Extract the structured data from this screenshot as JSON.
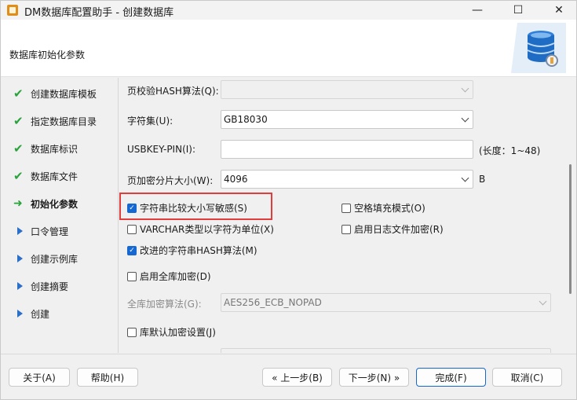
{
  "window": {
    "title": "DM数据库配置助手 - 创建数据库",
    "minimize": "—",
    "maximize": "☐",
    "close": "✕"
  },
  "header": {
    "title": "数据库初始化参数",
    "logo_icon": "database-settings-icon"
  },
  "sidebar": {
    "items": [
      {
        "label": "创建数据库模板",
        "state": "done"
      },
      {
        "label": "指定数据库目录",
        "state": "done"
      },
      {
        "label": "数据库标识",
        "state": "done"
      },
      {
        "label": "数据库文件",
        "state": "done"
      },
      {
        "label": "初始化参数",
        "state": "current"
      },
      {
        "label": "口令管理",
        "state": "pending"
      },
      {
        "label": "创建示例库",
        "state": "pending"
      },
      {
        "label": "创建摘要",
        "state": "pending"
      },
      {
        "label": "创建",
        "state": "pending"
      }
    ],
    "icons": {
      "done": "✔",
      "current": "➜"
    }
  },
  "form": {
    "page_hash": {
      "label": "页校验HASH算法(Q):",
      "value": ""
    },
    "charset": {
      "label": "字符集(U):",
      "value": "GB18030"
    },
    "usbkey": {
      "label": "USBKEY-PIN(I):",
      "value": "",
      "suffix": "(长度：1~48)"
    },
    "page_shard": {
      "label": "页加密分片大小(W):",
      "value": "4096",
      "suffix": "B"
    },
    "case_sensitive": {
      "label": "字符串比较大小写敏感(S)",
      "checked": true
    },
    "blank_pad": {
      "label": "空格填充模式(O)",
      "checked": false
    },
    "varchar_char": {
      "label": "VARCHAR类型以字符为单位(X)",
      "checked": false
    },
    "log_encrypt": {
      "label": "启用日志文件加密(R)",
      "checked": false
    },
    "improved_hash": {
      "label": "改进的字符串HASH算法(M)",
      "checked": true
    },
    "full_encrypt": {
      "label": "启用全库加密(D)",
      "checked": false
    },
    "encrypt_algo": {
      "label": "全库加密算法(G):",
      "value": "AES256_ECB_NOPAD"
    },
    "default_encrypt": {
      "label": "库默认加密设置(J)",
      "checked": false
    }
  },
  "footer": {
    "about": "关于(A)",
    "help": "帮助(H)",
    "prev": "« 上一步(B)",
    "next": "下一步(N) »",
    "finish": "完成(F)",
    "cancel": "取消(C)"
  },
  "colors": {
    "accent": "#1567d1",
    "done": "#27a33a",
    "highlight": "#e23d3d"
  }
}
